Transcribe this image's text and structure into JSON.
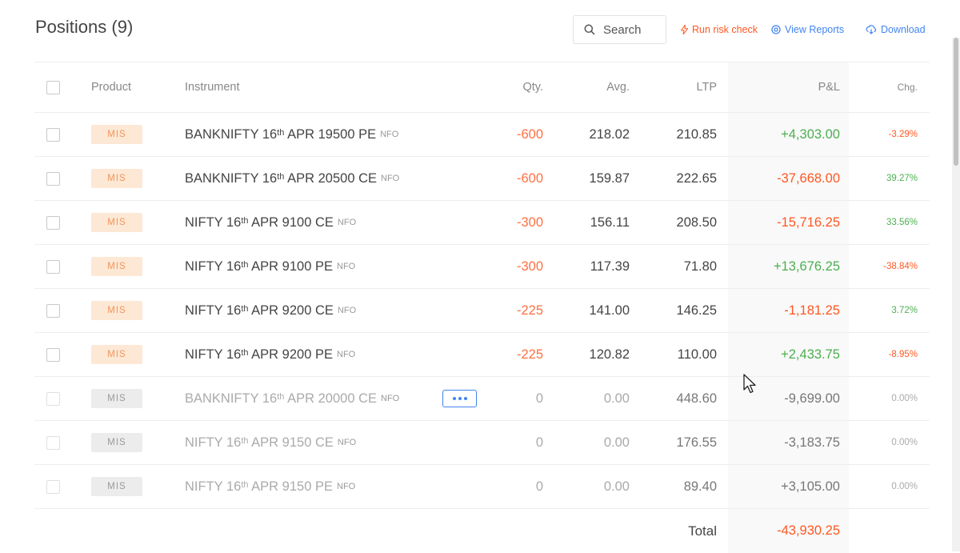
{
  "page": {
    "title": "Positions (9)",
    "search_placeholder": "Search",
    "actions": {
      "risk_check": "Run risk check",
      "view_reports": "View Reports",
      "download": "Download"
    }
  },
  "table": {
    "headers": {
      "product": "Product",
      "instrument": "Instrument",
      "qty": "Qty.",
      "avg": "Avg.",
      "ltp": "LTP",
      "pnl": "P&L",
      "chg": "Chg."
    },
    "rows": [
      {
        "product": "MIS",
        "inst_pre": "BANKNIFTY 16",
        "inst_sup": "th",
        "inst_post": " APR 19500 PE",
        "exchange": "NFO",
        "qty": "-600",
        "avg": "218.02",
        "ltp": "210.85",
        "pnl": "+4,303.00",
        "chg": "-3.29%"
      },
      {
        "product": "MIS",
        "inst_pre": "BANKNIFTY 16",
        "inst_sup": "th",
        "inst_post": " APR 20500 CE",
        "exchange": "NFO",
        "qty": "-600",
        "avg": "159.87",
        "ltp": "222.65",
        "pnl": "-37,668.00",
        "chg": "39.27%"
      },
      {
        "product": "MIS",
        "inst_pre": "NIFTY 16",
        "inst_sup": "th",
        "inst_post": " APR 9100 CE",
        "exchange": "NFO",
        "qty": "-300",
        "avg": "156.11",
        "ltp": "208.50",
        "pnl": "-15,716.25",
        "chg": "33.56%"
      },
      {
        "product": "MIS",
        "inst_pre": "NIFTY 16",
        "inst_sup": "th",
        "inst_post": " APR 9100 PE",
        "exchange": "NFO",
        "qty": "-300",
        "avg": "117.39",
        "ltp": "71.80",
        "pnl": "+13,676.25",
        "chg": "-38.84%"
      },
      {
        "product": "MIS",
        "inst_pre": "NIFTY 16",
        "inst_sup": "th",
        "inst_post": " APR 9200 CE",
        "exchange": "NFO",
        "qty": "-225",
        "avg": "141.00",
        "ltp": "146.25",
        "pnl": "-1,181.25",
        "chg": "3.72%"
      },
      {
        "product": "MIS",
        "inst_pre": "NIFTY 16",
        "inst_sup": "th",
        "inst_post": " APR 9200 PE",
        "exchange": "NFO",
        "qty": "-225",
        "avg": "120.82",
        "ltp": "110.00",
        "pnl": "+2,433.75",
        "chg": "-8.95%"
      },
      {
        "product": "MIS",
        "inst_pre": "BANKNIFTY 16",
        "inst_sup": "th",
        "inst_post": " APR 20000 CE",
        "exchange": "NFO",
        "qty": "0",
        "avg": "0.00",
        "ltp": "448.60",
        "pnl": "-9,699.00",
        "chg": "0.00%"
      },
      {
        "product": "MIS",
        "inst_pre": "NIFTY 16",
        "inst_sup": "th",
        "inst_post": " APR 9150 CE",
        "exchange": "NFO",
        "qty": "0",
        "avg": "0.00",
        "ltp": "176.55",
        "pnl": "-3,183.75",
        "chg": "0.00%"
      },
      {
        "product": "MIS",
        "inst_pre": "NIFTY 16",
        "inst_sup": "th",
        "inst_post": " APR 9150 PE",
        "exchange": "NFO",
        "qty": "0",
        "avg": "0.00",
        "ltp": "89.40",
        "pnl": "+3,105.00",
        "chg": "0.00%"
      }
    ],
    "total_label": "Total",
    "total_value": "-43,930.25"
  },
  "colors": {
    "loss": "#ff5722",
    "profit": "#4caf50",
    "link": "#4184f3",
    "mis_badge_bg": "#fde8d5"
  },
  "icons": [
    "search-icon",
    "bolt-icon",
    "reports-icon",
    "cloud-download-icon",
    "more-options-icon",
    "mouse-cursor-icon"
  ]
}
